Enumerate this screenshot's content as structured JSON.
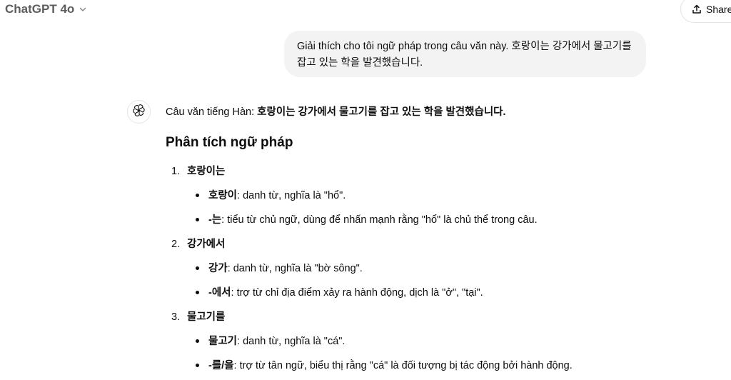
{
  "header": {
    "model_name": "ChatGPT 4o",
    "share_label": "Share"
  },
  "user_message": {
    "text": "Giải thích cho tôi ngữ pháp trong câu văn này. 호랑이는 강가에서 물고기를 잡고 있는 학을 발견했습니다."
  },
  "assistant": {
    "intro_prefix": "Câu văn tiếng Hàn: ",
    "intro_sentence": "호랑이는 강가에서 물고기를 잡고 있는 학을 발견했습니다.",
    "heading": "Phân tích ngữ pháp",
    "sections": [
      {
        "number": "1.",
        "title": "호랑이는",
        "bullets": [
          {
            "term": "호랑이",
            "text": ": danh từ, nghĩa là \"hổ\"."
          },
          {
            "term": "-는",
            "text": ": tiểu từ chủ ngữ, dùng để nhấn mạnh rằng \"hổ\" là chủ thể trong câu."
          }
        ]
      },
      {
        "number": "2.",
        "title": "강가에서",
        "bullets": [
          {
            "term": "강가",
            "text": ": danh từ, nghĩa là \"bờ sông\"."
          },
          {
            "term": "-에서",
            "text": ": trợ từ chỉ địa điểm xảy ra hành động, dịch là \"ở\", \"tại\"."
          }
        ]
      },
      {
        "number": "3.",
        "title": "물고기를",
        "bullets": [
          {
            "term": "물고기",
            "text": ": danh từ, nghĩa là \"cá\"."
          },
          {
            "term": "-를/을",
            "text": ": trợ từ tân ngữ, biểu thị rằng \"cá\" là đối tượng bị tác động bởi hành động."
          }
        ]
      }
    ]
  }
}
